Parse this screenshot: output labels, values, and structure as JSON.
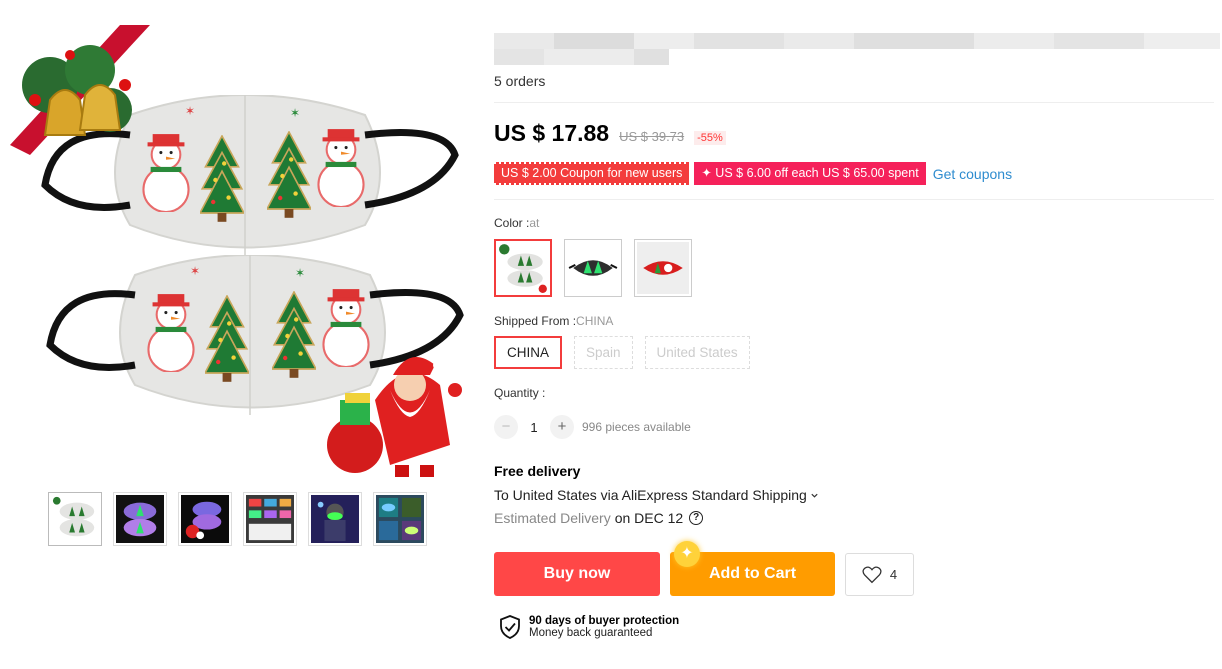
{
  "product": {
    "orders": "5 orders",
    "price": "US $ 17.88",
    "original_price": "US $ 39.73",
    "discount": "-55%"
  },
  "coupons": {
    "new_user": "US $ 2.00 Coupon for new users",
    "spend_off": "✦ US $ 6.00 off each US $ 65.00 spent",
    "get_link": "Get coupons"
  },
  "color": {
    "label": "Color :",
    "selected": "at",
    "options": [
      "snowman-mask",
      "dark-tree-mask",
      "red-green-mask"
    ]
  },
  "shipped_from": {
    "label": "Shipped From :",
    "selected": "CHINA",
    "options": [
      "CHINA",
      "Spain",
      "United States"
    ]
  },
  "quantity": {
    "label": "Quantity :",
    "minus": "−",
    "plus": "+",
    "value": "1",
    "available": "996 pieces available"
  },
  "delivery": {
    "free": "Free delivery",
    "route": "To United States via AliExpress Standard Shipping",
    "estimated_label": "Estimated Delivery",
    "estimated_date": "on DEC 12"
  },
  "actions": {
    "buy_now": "Buy now",
    "add_to_cart": "Add to Cart",
    "wishlist_count": "4"
  },
  "protection": {
    "title": "90 days of buyer protection",
    "subtitle": "Money back guaranteed"
  },
  "gallery": {
    "thumbnails": [
      "snowman-masks",
      "purple-glow-masks",
      "glow-masks-santa",
      "multi-color-masks",
      "person-glow-mask",
      "assorted-masks"
    ]
  },
  "colors": {
    "accent_red": "#ff4747",
    "accent_orange": "#ff9c00",
    "link_blue": "#2e8ccf"
  }
}
